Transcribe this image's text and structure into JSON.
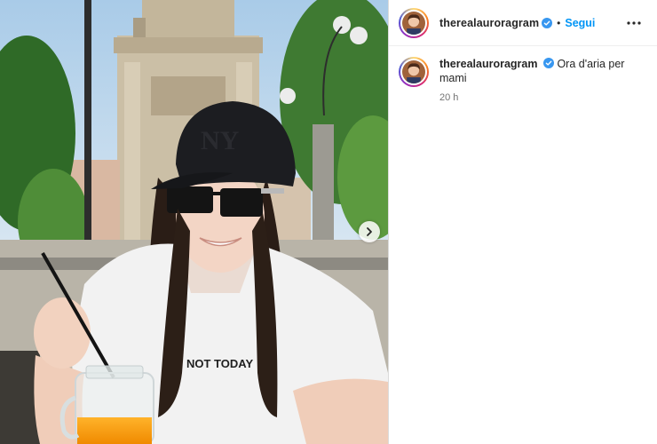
{
  "post": {
    "username": "therealauroragram",
    "verified": true,
    "follow_label": "Segui",
    "caption": "Ora d'aria per mami",
    "time_ago": "20 h",
    "tshirt_text": "NOT TODAY"
  },
  "colors": {
    "follow": "#0095f6",
    "verified": "#3897f0",
    "timestamp": "#737373"
  },
  "icons": {
    "more": "more-options-icon",
    "verified": "verified-badge-icon",
    "next": "chevron-right-icon"
  }
}
